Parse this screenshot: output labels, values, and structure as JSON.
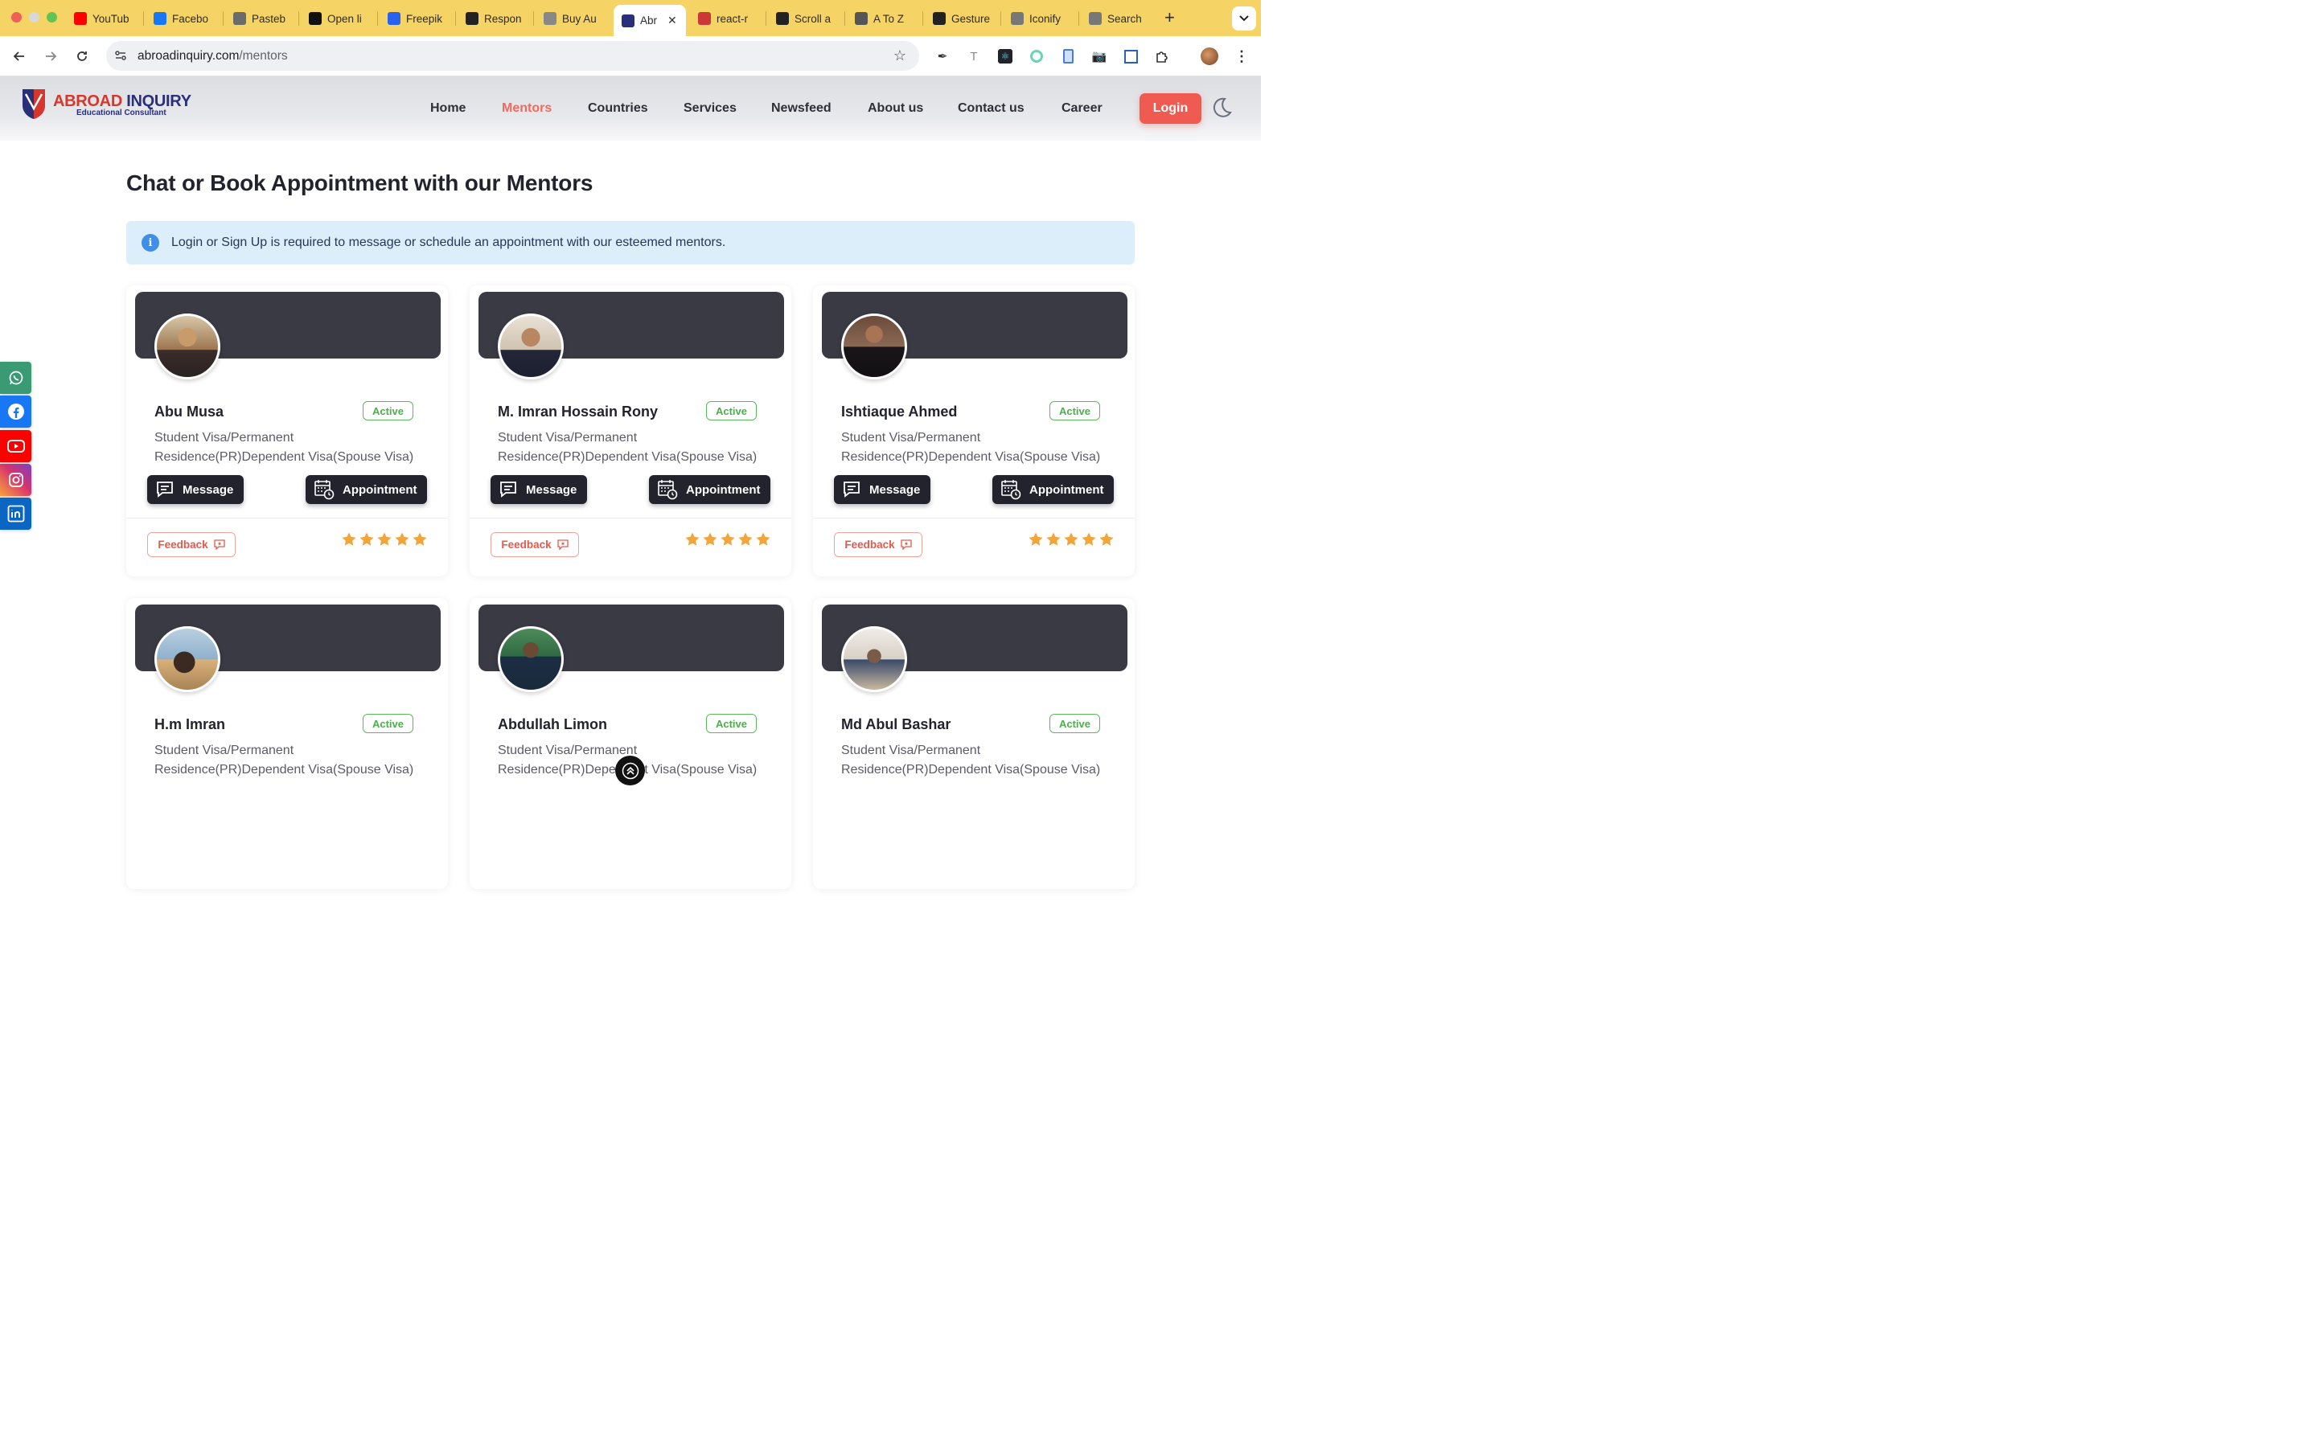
{
  "browser": {
    "tabs": [
      {
        "label": "YouTub",
        "icon": "youtube-icon",
        "color": "#ff0000"
      },
      {
        "label": "Facebo",
        "icon": "facebook-icon",
        "color": "#1877f2"
      },
      {
        "label": "Pasteb",
        "icon": "pastebin-icon",
        "color": "#6b6b6b"
      },
      {
        "label": "Open li",
        "icon": "openai-icon",
        "color": "#111111"
      },
      {
        "label": "Freepik",
        "icon": "freepik-icon",
        "color": "#2a62f0"
      },
      {
        "label": "Respon",
        "icon": "responsive-icon",
        "color": "#222222"
      },
      {
        "label": "Buy Au",
        "icon": "buy-icon",
        "color": "#888888"
      },
      {
        "label": "Abr",
        "icon": "abroad-inquiry-icon",
        "color": "#2a2f7a"
      },
      {
        "label": "react-r",
        "icon": "npm-icon",
        "color": "#cb3837"
      },
      {
        "label": "Scroll a",
        "icon": "pmndrs-icon",
        "color": "#222222"
      },
      {
        "label": "A To Z",
        "icon": "atoz-icon",
        "color": "#555555"
      },
      {
        "label": "Gesture",
        "icon": "pmndrs-icon",
        "color": "#222222"
      },
      {
        "label": "Iconify",
        "icon": "iconify-icon",
        "color": "#777777"
      },
      {
        "label": "Search",
        "icon": "iconify-icon",
        "color": "#777777"
      }
    ],
    "active_tab_index": 7,
    "url_domain": "abroadinquiry.com",
    "url_path": "/mentors"
  },
  "site": {
    "logo_primary": "ABROAD",
    "logo_secondary": "INQUIRY",
    "logo_tagline": "Educational Consultant",
    "nav": [
      "Home",
      "Mentors",
      "Countries",
      "Services",
      "Newsfeed",
      "About us",
      "Contact us",
      "Career"
    ],
    "active_nav": "Mentors",
    "login_label": "Login",
    "accent_color": "#ef5b50"
  },
  "page": {
    "title": "Chat or Book Appointment with our Mentors",
    "alert": "Login or Sign Up is required to message or schedule an appointment with our esteemed mentors."
  },
  "mentors": [
    {
      "name": "Abu Musa",
      "status": "Active",
      "services_line1": "Student Visa/Permanent",
      "services_line2": "Residence(PR)Dependent Visa(Spouse Visa)",
      "message_label": "Message",
      "appointment_label": "Appointment",
      "feedback_label": "Feedback",
      "rating": 5
    },
    {
      "name": "M. Imran Hossain Rony",
      "status": "Active",
      "services_line1": "Student Visa/Permanent",
      "services_line2": "Residence(PR)Dependent Visa(Spouse Visa)",
      "message_label": "Message",
      "appointment_label": "Appointment",
      "feedback_label": "Feedback",
      "rating": 5
    },
    {
      "name": "Ishtiaque Ahmed",
      "status": "Active",
      "services_line1": "Student Visa/Permanent",
      "services_line2": "Residence(PR)Dependent Visa(Spouse Visa)",
      "message_label": "Message",
      "appointment_label": "Appointment",
      "feedback_label": "Feedback",
      "rating": 5
    },
    {
      "name": "H.m Imran",
      "status": "Active",
      "services_line1": "Student Visa/Permanent",
      "services_line2": "Residence(PR)Dependent Visa(Spouse Visa)"
    },
    {
      "name": "Abdullah Limon",
      "status": "Active",
      "services_line1": "Student Visa/Permanent",
      "services_line2": "Residence(PR)Dependent Visa(Spouse Visa)"
    },
    {
      "name": "Md Abul Bashar",
      "status": "Active",
      "services_line1": "Student Visa/Permanent",
      "services_line2": "Residence(PR)Dependent Visa(Spouse Visa)"
    }
  ],
  "social": [
    {
      "icon": "whatsapp-icon",
      "color": "#3a9a74"
    },
    {
      "icon": "facebook-icon",
      "color": "#1877f2"
    },
    {
      "icon": "youtube-icon",
      "color": "#ff0000"
    },
    {
      "icon": "instagram-icon",
      "color": "#d6336c"
    },
    {
      "icon": "linkedin-icon",
      "color": "#0a66c2"
    }
  ]
}
